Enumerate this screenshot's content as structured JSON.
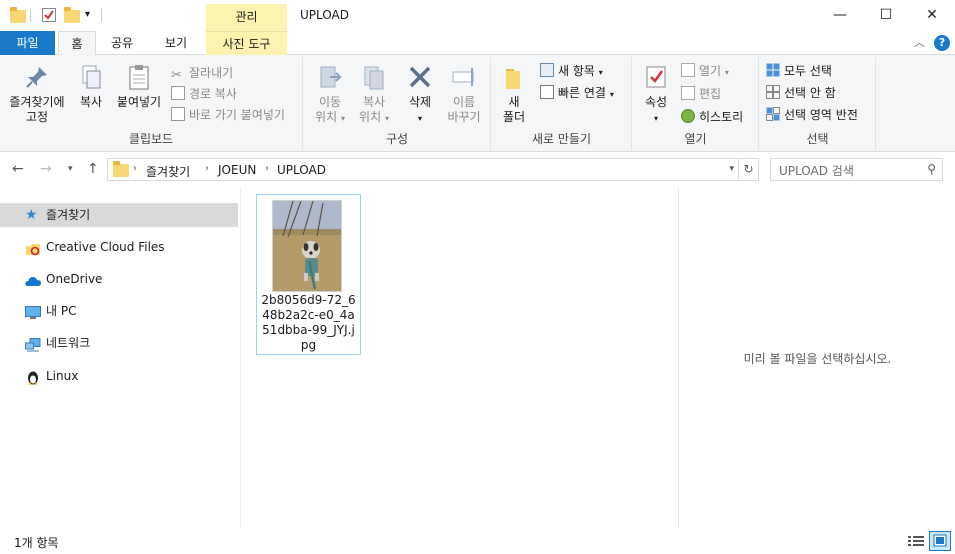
{
  "titlebar": {
    "context_tab": "관리",
    "title": "UPLOAD",
    "minimize": "—",
    "maximize": "☐",
    "close": "✕"
  },
  "tabs": {
    "file": "파일",
    "home": "홈",
    "share": "공유",
    "view": "보기",
    "picture_tools": "사진 도구"
  },
  "ribbon": {
    "clipboard": {
      "pin_line1": "즐겨찾기에",
      "pin_line2": "고정",
      "copy": "복사",
      "paste": "붙여넣기",
      "cut": "잘라내기",
      "copy_path": "경로 복사",
      "paste_shortcut": "바로 가기 붙여넣기",
      "label": "클립보드"
    },
    "organize": {
      "move_to_line1": "이동",
      "move_to_line2": "위치",
      "copy_to_line1": "복사",
      "copy_to_line2": "위치",
      "delete": "삭제",
      "rename_line1": "이름",
      "rename_line2": "바꾸기",
      "label": "구성"
    },
    "new": {
      "new_folder_line1": "새",
      "new_folder_line2": "폴더",
      "new_item": "새 항목",
      "easy_access": "빠른 연결",
      "label": "새로 만들기"
    },
    "open": {
      "properties": "속성",
      "open": "열기",
      "edit": "편집",
      "history": "히스토리",
      "label": "열기"
    },
    "select": {
      "select_all": "모두 선택",
      "select_none": "선택 안 함",
      "invert": "선택 영역 반전",
      "label": "선택"
    }
  },
  "address": {
    "crumbs": [
      "즐겨찾기",
      "JOEUN",
      "UPLOAD"
    ],
    "search_placeholder": "UPLOAD 검색"
  },
  "sidebar": {
    "items": [
      {
        "label": "즐겨찾기",
        "icon": "star-icon"
      },
      {
        "label": "Creative Cloud Files",
        "icon": "creative-cloud-icon"
      },
      {
        "label": "OneDrive",
        "icon": "cloud-icon"
      },
      {
        "label": "내 PC",
        "icon": "computer-icon"
      },
      {
        "label": "네트워크",
        "icon": "network-icon"
      },
      {
        "label": "Linux",
        "icon": "linux-icon"
      }
    ]
  },
  "files": [
    {
      "name": "2b8056d9-72_648b2a2c-e0_4a51dbba-99_JYJ.jpg"
    }
  ],
  "preview": {
    "message": "미리 볼 파일을 선택하십시오."
  },
  "status": {
    "count": "1개 항목"
  },
  "colors": {
    "accent": "#1979ca",
    "context_tab": "#fcf3b0",
    "selected_nav": "#d9d9d9"
  }
}
